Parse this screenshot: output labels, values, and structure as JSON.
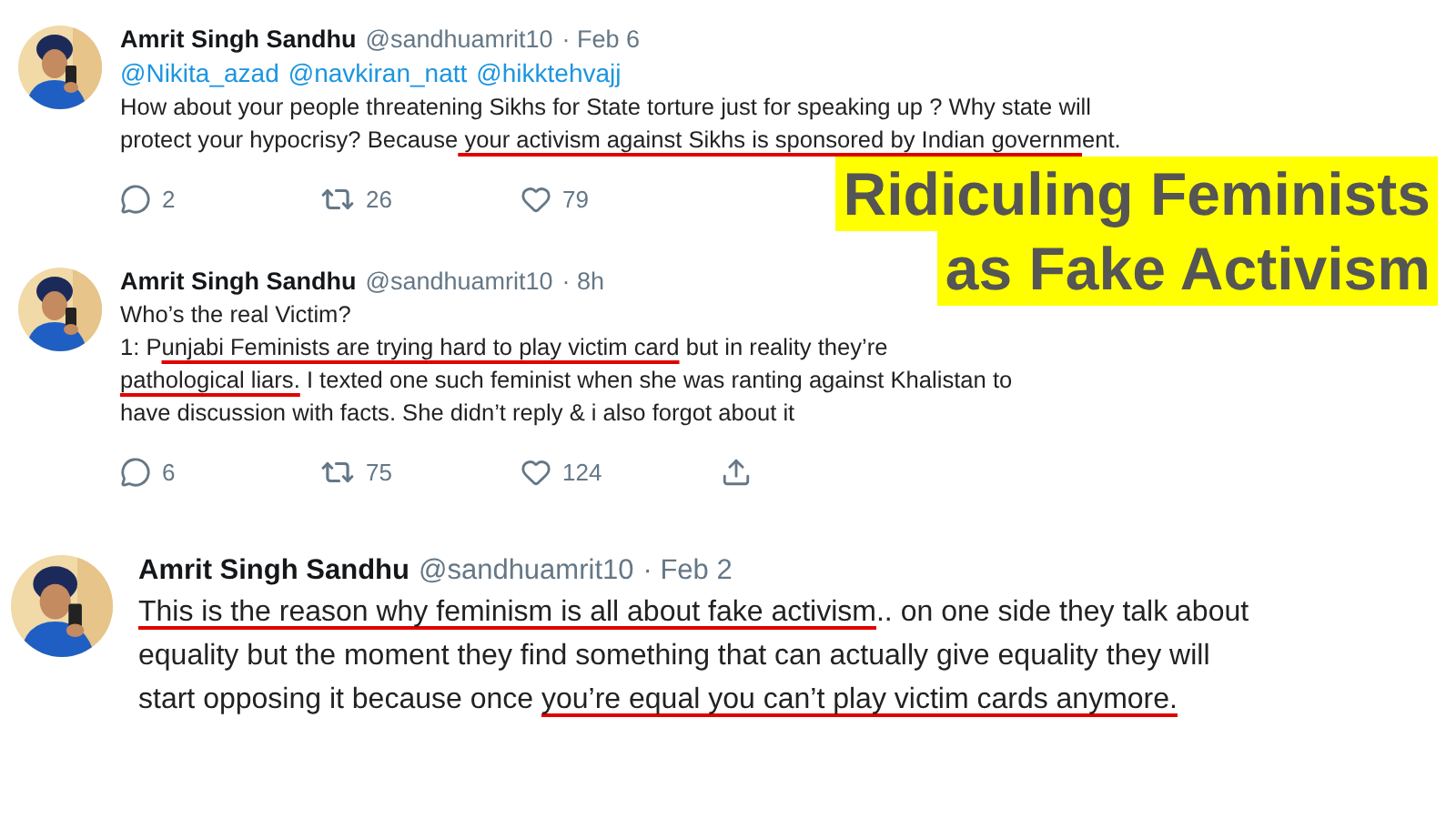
{
  "tweets": [
    {
      "name": "Amrit Singh Sandhu",
      "handle": "@sandhuamrit10",
      "time": "· Feb 6",
      "mentions": [
        "@Nikita_azad",
        "@navkiran_natt",
        "@hikktehvajj"
      ],
      "segments": [
        {
          "text": "How about your people threatening Sikhs for State torture just for speaking up ? Why state will\nprotect your hypocrisy? Because",
          "underlined": false
        },
        {
          "text": " your activism against Sikhs is sponsored by Indian governm",
          "underlined": true
        },
        {
          "text": "ent.",
          "underlined": false
        }
      ],
      "actions": [
        {
          "kind": "reply",
          "count": "2"
        },
        {
          "kind": "retweet",
          "count": "26"
        },
        {
          "kind": "like",
          "count": "79"
        }
      ]
    },
    {
      "name": "Amrit Singh Sandhu",
      "handle": "@sandhuamrit10",
      "time": "· 8h",
      "segments": [
        {
          "text": "Who’s the real Victim?\n1: P",
          "underlined": false
        },
        {
          "text": "unjabi Feminists are trying hard to play victim card",
          "underlined": true
        },
        {
          "text": " but in reality they’re\n",
          "underlined": false
        },
        {
          "text": "pathological liars.",
          "underlined": true
        },
        {
          "text": " I texted one such feminist when she was ranting against Khalistan to\nhave discussion with facts. She didn’t reply & i also forgot about it",
          "underlined": false
        }
      ],
      "actions": [
        {
          "kind": "reply",
          "count": "6"
        },
        {
          "kind": "retweet",
          "count": "75"
        },
        {
          "kind": "like",
          "count": "124"
        },
        {
          "kind": "share"
        }
      ]
    },
    {
      "name": "Amrit Singh Sandhu",
      "handle": "@sandhuamrit10",
      "time": "· Feb 2",
      "segments": [
        {
          "text": "This is the reason why feminism is all about fake activism",
          "underlined": true
        },
        {
          "text": ".. on one side they talk about\nequality but the moment they find something that can actually give equality they will\nstart opposing it because once ",
          "underlined": false
        },
        {
          "text": "you’re equal you can’t play victim cards anymore.",
          "underlined": true
        }
      ]
    }
  ],
  "headline": [
    "Ridiculing Feminists",
    "as Fake Activism"
  ]
}
